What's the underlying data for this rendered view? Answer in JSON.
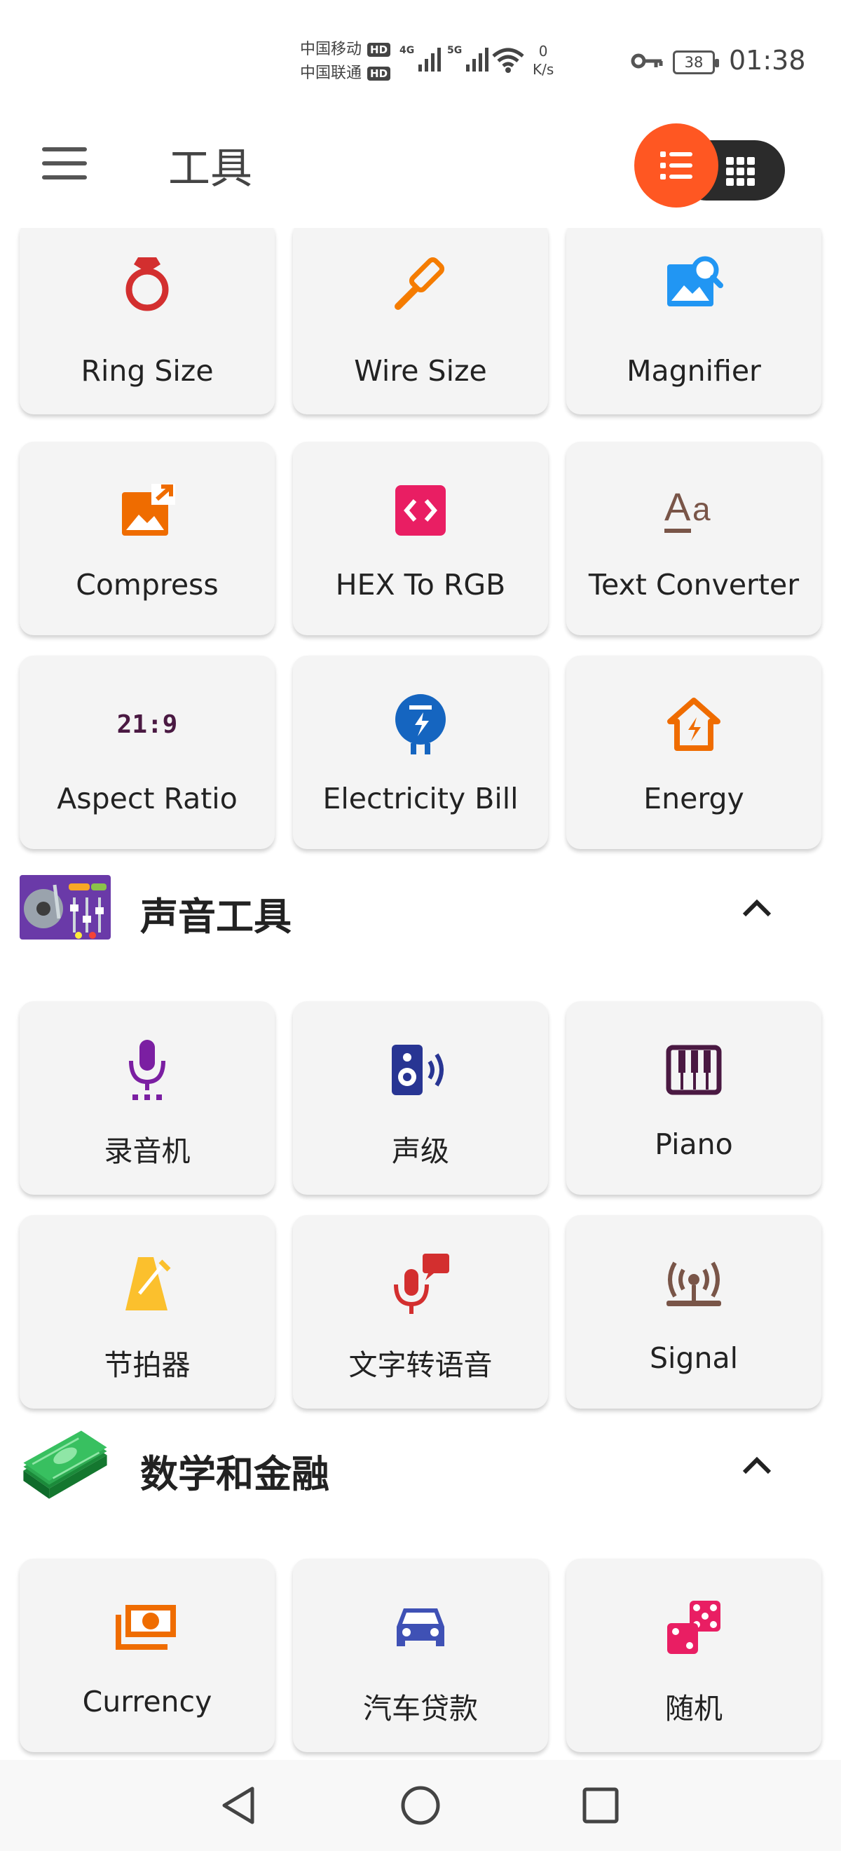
{
  "status_bar": {
    "carrier1": "中国移动",
    "carrier2": "中国联通",
    "hd": "HD",
    "net1": "4G",
    "net2": "5G",
    "speed_value": "0",
    "speed_unit": "K/s",
    "battery": "38",
    "time": "01:38"
  },
  "app_bar": {
    "title": "工具",
    "menu_icon": "hamburger-menu-icon",
    "list_view_icon": "list-view-icon",
    "grid_view_icon": "grid-view-icon",
    "accent_color": "#ff5722"
  },
  "top_tools": [
    {
      "label": "Ring Size",
      "icon": "ring-icon",
      "color": "#d32f2f"
    },
    {
      "label": "Wire Size",
      "icon": "screwdriver-icon",
      "color": "#f57c00"
    },
    {
      "label": "Magnifier",
      "icon": "image-search-icon",
      "color": "#2196f3"
    },
    {
      "label": "Compress",
      "icon": "image-export-icon",
      "color": "#ef6c00"
    },
    {
      "label": "HEX To RGB",
      "icon": "code-icon",
      "color": "#e91e63"
    },
    {
      "label": "Text Converter",
      "icon": "text-case-icon",
      "color": "#795548"
    },
    {
      "label": "Aspect Ratio",
      "icon": "aspect-ratio-icon",
      "icon_text": "21:9",
      "color": "#4a1942"
    },
    {
      "label": "Electricity Bill",
      "icon": "electric-meter-icon",
      "color": "#1565c0"
    },
    {
      "label": "Energy",
      "icon": "home-lightning-icon",
      "color": "#ef6c00"
    }
  ],
  "sound_section": {
    "title": "声音工具",
    "icon": "turntable-icon",
    "collapse_icon": "chevron-up-icon",
    "tools": [
      {
        "label": "录音机",
        "icon": "microphone-icon",
        "color": "#7b1fa2"
      },
      {
        "label": "声级",
        "icon": "speaker-icon",
        "color": "#283593"
      },
      {
        "label": "Piano",
        "icon": "piano-icon",
        "color": "#4a1942"
      },
      {
        "label": "节拍器",
        "icon": "metronome-icon",
        "color": "#fbc02d"
      },
      {
        "label": "文字转语音",
        "icon": "speech-icon",
        "color": "#d32f2f"
      },
      {
        "label": "Signal",
        "icon": "antenna-icon",
        "color": "#795548"
      }
    ]
  },
  "math_section": {
    "title": "数学和金融",
    "icon": "money-stack-icon",
    "collapse_icon": "chevron-up-icon",
    "tools": [
      {
        "label": "Currency",
        "icon": "cash-icon",
        "color": "#ef6c00"
      },
      {
        "label": "汽车贷款",
        "icon": "car-icon",
        "color": "#3f51b5"
      },
      {
        "label": "随机",
        "icon": "dice-icon",
        "color": "#e91e63"
      }
    ]
  },
  "nav_bar": {
    "back_icon": "back-triangle-icon",
    "home_icon": "home-circle-icon",
    "recents_icon": "recents-square-icon"
  }
}
